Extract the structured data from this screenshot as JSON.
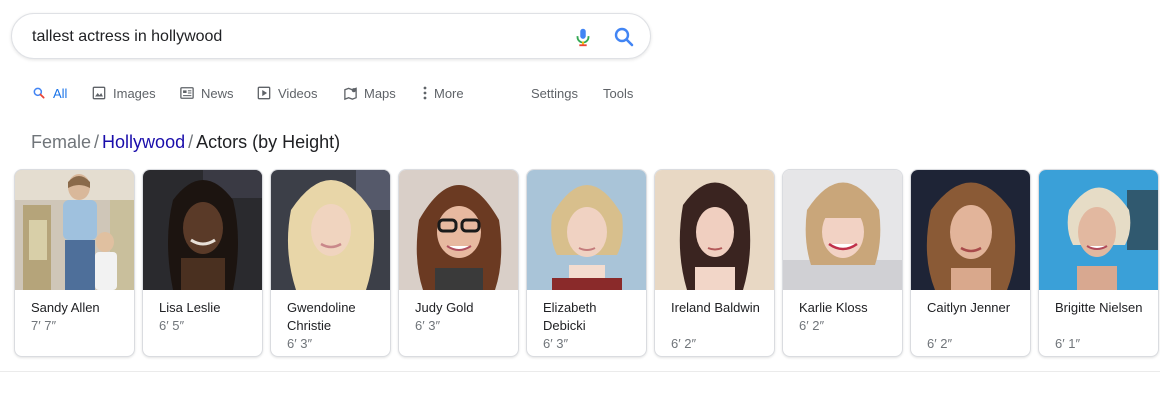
{
  "search": {
    "query": "tallest actress in hollywood"
  },
  "tabs": [
    {
      "label": "All",
      "icon": "search-icon",
      "active": true
    },
    {
      "label": "Images",
      "icon": "image-icon"
    },
    {
      "label": "News",
      "icon": "news-icon"
    },
    {
      "label": "Videos",
      "icon": "video-icon"
    },
    {
      "label": "Maps",
      "icon": "map-pin-icon"
    },
    {
      "label": "More",
      "icon": "more-vertical-icon"
    },
    {
      "label": "Settings"
    },
    {
      "label": "Tools"
    }
  ],
  "breadcrumb": {
    "first": "Female",
    "link": "Hollywood",
    "current": "Actors (by Height)",
    "separator": "/"
  },
  "people": [
    {
      "name": "Sandy Allen",
      "height": "7′ 7″"
    },
    {
      "name": "Lisa Leslie",
      "height": "6′ 5″"
    },
    {
      "name": "Gwendoline Christie",
      "height": "6′ 3″"
    },
    {
      "name": "Judy Gold",
      "height": "6′ 3″"
    },
    {
      "name": "Elizabeth Debicki",
      "height": "6′ 3″"
    },
    {
      "name": "Ireland Baldwin",
      "height": "6′ 2″"
    },
    {
      "name": "Karlie Kloss",
      "height": "6′ 2″"
    },
    {
      "name": "Caitlyn Jenner",
      "height": "6′ 2″"
    },
    {
      "name": "Brigitte Nielsen",
      "height": "6′ 1″"
    }
  ],
  "colors": {
    "accent": "#1a73e8",
    "link": "#1a0dab",
    "muted": "#70757a"
  }
}
